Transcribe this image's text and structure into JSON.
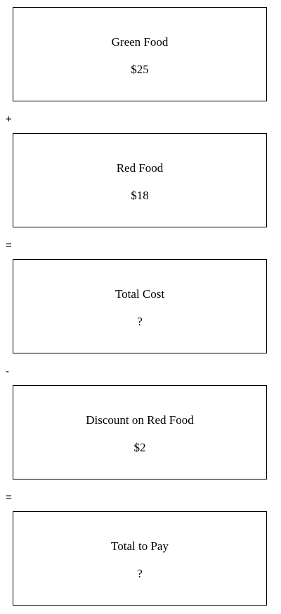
{
  "boxes": [
    {
      "label": "Green Food",
      "value": "$25"
    },
    {
      "label": "Red Food",
      "value": "$18"
    },
    {
      "label": "Total Cost",
      "value": "?"
    },
    {
      "label": "Discount on Red Food",
      "value": "$2"
    },
    {
      "label": "Total to Pay",
      "value": "?"
    }
  ],
  "operators": [
    "+",
    "=",
    "-",
    "="
  ]
}
